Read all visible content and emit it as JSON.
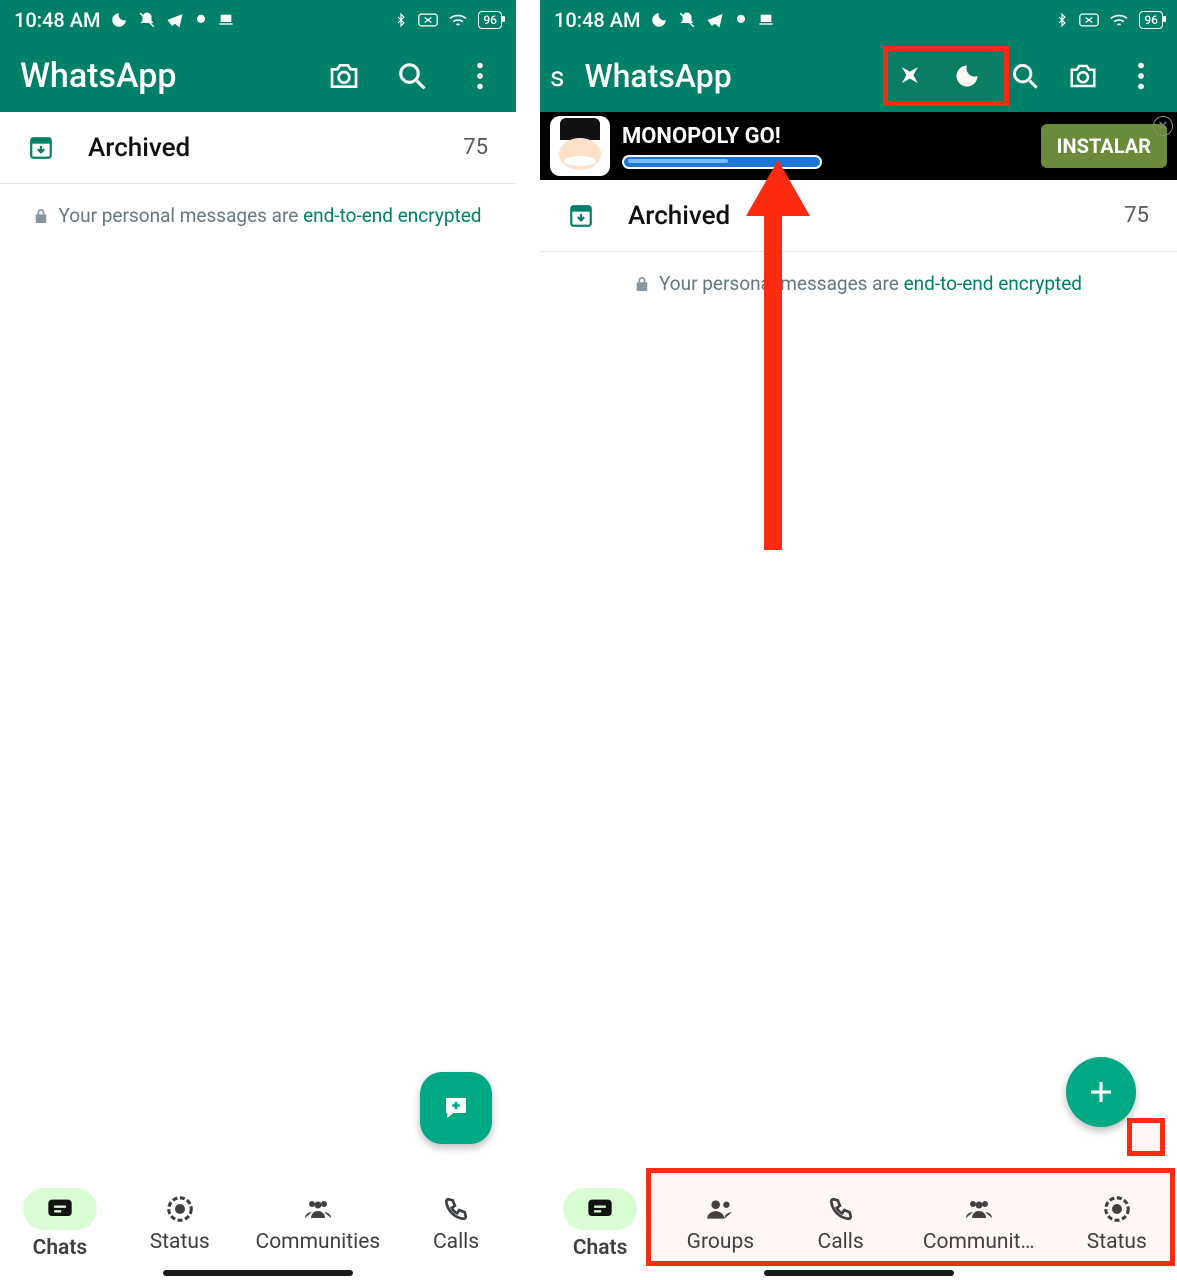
{
  "status": {
    "time": "10:48 AM",
    "battery": "96"
  },
  "left": {
    "app_title": "WhatsApp",
    "archived_label": "Archived",
    "archived_count": "75",
    "encrypt_prefix": "Your personal messages are ",
    "encrypt_link": "end-to-end encrypted",
    "nav": [
      "Chats",
      "Status",
      "Communities",
      "Calls"
    ]
  },
  "right": {
    "peek": "s",
    "app_title": "WhatsApp",
    "ad_title": "MONOPOLY GO!",
    "ad_button": "INSTALAR",
    "archived_label": "Archived",
    "archived_count": "75",
    "encrypt_prefix": "Your personal messages are ",
    "encrypt_link": "end-to-end encrypted",
    "nav": [
      "Chats",
      "Groups",
      "Calls",
      "Communit…",
      "Status"
    ]
  },
  "colors": {
    "primary": "#008069",
    "accent": "#00a884",
    "highlight": "#ff2a12"
  }
}
